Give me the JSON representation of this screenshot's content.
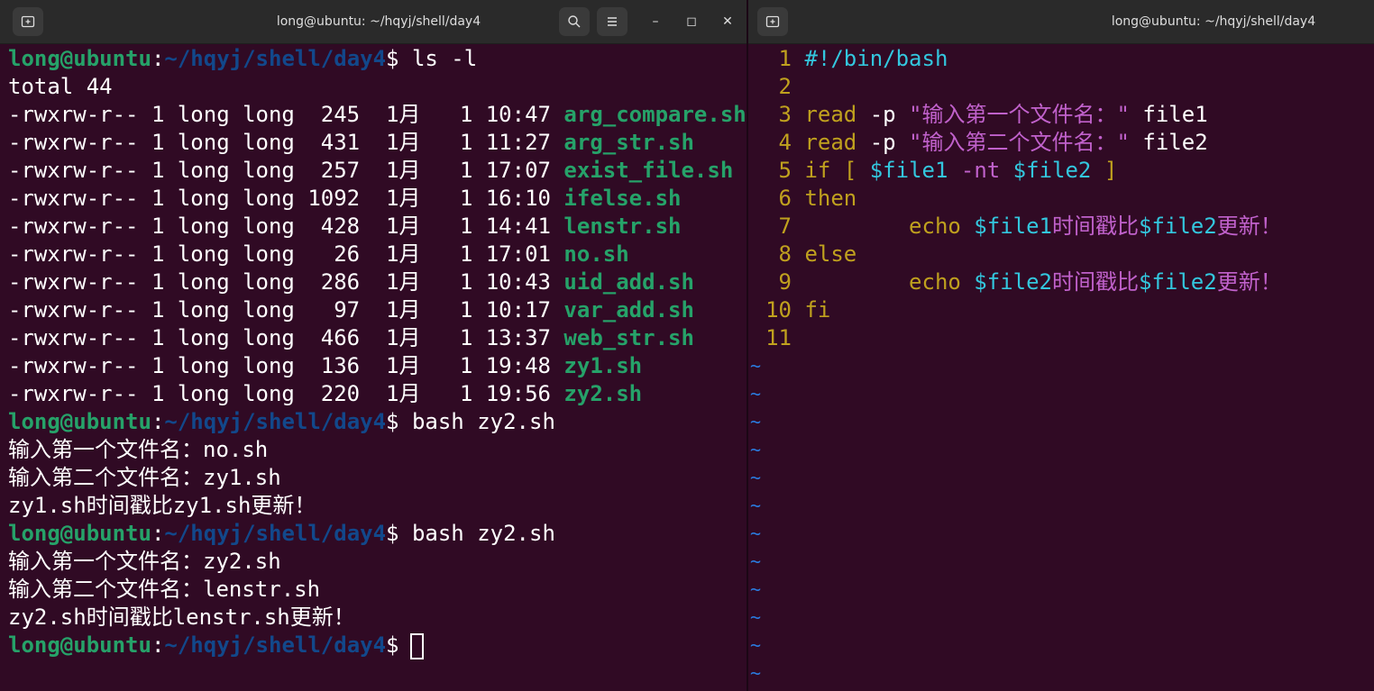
{
  "left_window": {
    "title": "long@ubuntu: ~/hqyj/shell/day4",
    "new_tab_icon": "new-tab-icon",
    "search_icon": "search-icon",
    "menu_icon": "hamburger-menu-icon",
    "min_label": "–",
    "max_label": "◻",
    "close_label": "✕"
  },
  "right_window": {
    "title": "long@ubuntu: ~/hqyj/shell/day4"
  },
  "prompt": {
    "user_host": "long@ubuntu",
    "colon": ":",
    "path": "~/hqyj/shell/day4",
    "dollar": "$"
  },
  "terminal": {
    "cmd1": " ls -l",
    "total": "total 44",
    "files": [
      {
        "meta": "-rwxrw-r-- 1 long long  245  1月   1 10:47 ",
        "name": "arg_compare.sh"
      },
      {
        "meta": "-rwxrw-r-- 1 long long  431  1月   1 11:27 ",
        "name": "arg_str.sh"
      },
      {
        "meta": "-rwxrw-r-- 1 long long  257  1月   1 17:07 ",
        "name": "exist_file.sh"
      },
      {
        "meta": "-rwxrw-r-- 1 long long 1092  1月   1 16:10 ",
        "name": "ifelse.sh"
      },
      {
        "meta": "-rwxrw-r-- 1 long long  428  1月   1 14:41 ",
        "name": "lenstr.sh"
      },
      {
        "meta": "-rwxrw-r-- 1 long long   26  1月   1 17:01 ",
        "name": "no.sh"
      },
      {
        "meta": "-rwxrw-r-- 1 long long  286  1月   1 10:43 ",
        "name": "uid_add.sh"
      },
      {
        "meta": "-rwxrw-r-- 1 long long   97  1月   1 10:17 ",
        "name": "var_add.sh"
      },
      {
        "meta": "-rwxrw-r-- 1 long long  466  1月   1 13:37 ",
        "name": "web_str.sh"
      },
      {
        "meta": "-rwxrw-r-- 1 long long  136  1月   1 19:48 ",
        "name": "zy1.sh"
      },
      {
        "meta": "-rwxrw-r-- 1 long long  220  1月   1 19:56 ",
        "name": "zy2.sh"
      }
    ],
    "cmd2": " bash zy2.sh",
    "run1": [
      "输入第一个文件名：no.sh",
      "输入第二个文件名：zy1.sh",
      "zy1.sh时间戳比zy1.sh更新！"
    ],
    "cmd3": " bash zy2.sh",
    "run2": [
      "输入第一个文件名：zy2.sh",
      "输入第二个文件名：lenstr.sh",
      "zy2.sh时间戳比lenstr.sh更新！"
    ]
  },
  "editor": {
    "lines": [
      {
        "num": "1",
        "parts": [
          {
            "t": "#!/bin/bash",
            "c": "cyan"
          }
        ]
      },
      {
        "num": "2",
        "parts": []
      },
      {
        "num": "3",
        "parts": [
          {
            "t": "read",
            "c": "yel"
          },
          {
            "t": " -p ",
            "c": ""
          },
          {
            "t": "\"输入第一个文件名：\"",
            "c": "mag"
          },
          {
            "t": " file1",
            "c": ""
          }
        ]
      },
      {
        "num": "4",
        "parts": [
          {
            "t": "read",
            "c": "yel"
          },
          {
            "t": " -p ",
            "c": ""
          },
          {
            "t": "\"输入第二个文件名：\"",
            "c": "mag"
          },
          {
            "t": " file2",
            "c": ""
          }
        ]
      },
      {
        "num": "5",
        "parts": [
          {
            "t": "if",
            "c": "yel"
          },
          {
            "t": " ",
            "c": ""
          },
          {
            "t": "[",
            "c": "yel"
          },
          {
            "t": " ",
            "c": ""
          },
          {
            "t": "$file1",
            "c": "cyan"
          },
          {
            "t": " -nt ",
            "c": "mag"
          },
          {
            "t": "$file2",
            "c": "cyan"
          },
          {
            "t": " ",
            "c": ""
          },
          {
            "t": "]",
            "c": "yel"
          }
        ]
      },
      {
        "num": "6",
        "parts": [
          {
            "t": "then",
            "c": "yel"
          }
        ]
      },
      {
        "num": "7",
        "parts": [
          {
            "t": "        ",
            "c": ""
          },
          {
            "t": "echo",
            "c": "yel"
          },
          {
            "t": " ",
            "c": ""
          },
          {
            "t": "$file1",
            "c": "cyan"
          },
          {
            "t": "时间戳比",
            "c": "mag"
          },
          {
            "t": "$file2",
            "c": "cyan"
          },
          {
            "t": "更新！",
            "c": "mag"
          }
        ]
      },
      {
        "num": "8",
        "parts": [
          {
            "t": "else",
            "c": "yel"
          }
        ]
      },
      {
        "num": "9",
        "parts": [
          {
            "t": "        ",
            "c": ""
          },
          {
            "t": "echo",
            "c": "yel"
          },
          {
            "t": " ",
            "c": ""
          },
          {
            "t": "$file2",
            "c": "cyan"
          },
          {
            "t": "时间戳比",
            "c": "mag"
          },
          {
            "t": "$file2",
            "c": "cyan"
          },
          {
            "t": "更新！",
            "c": "mag"
          }
        ]
      },
      {
        "num": "10",
        "parts": [
          {
            "t": "fi",
            "c": "yel"
          }
        ]
      },
      {
        "num": "11",
        "parts": []
      }
    ],
    "tilde": "~",
    "tilde_count": 12
  }
}
